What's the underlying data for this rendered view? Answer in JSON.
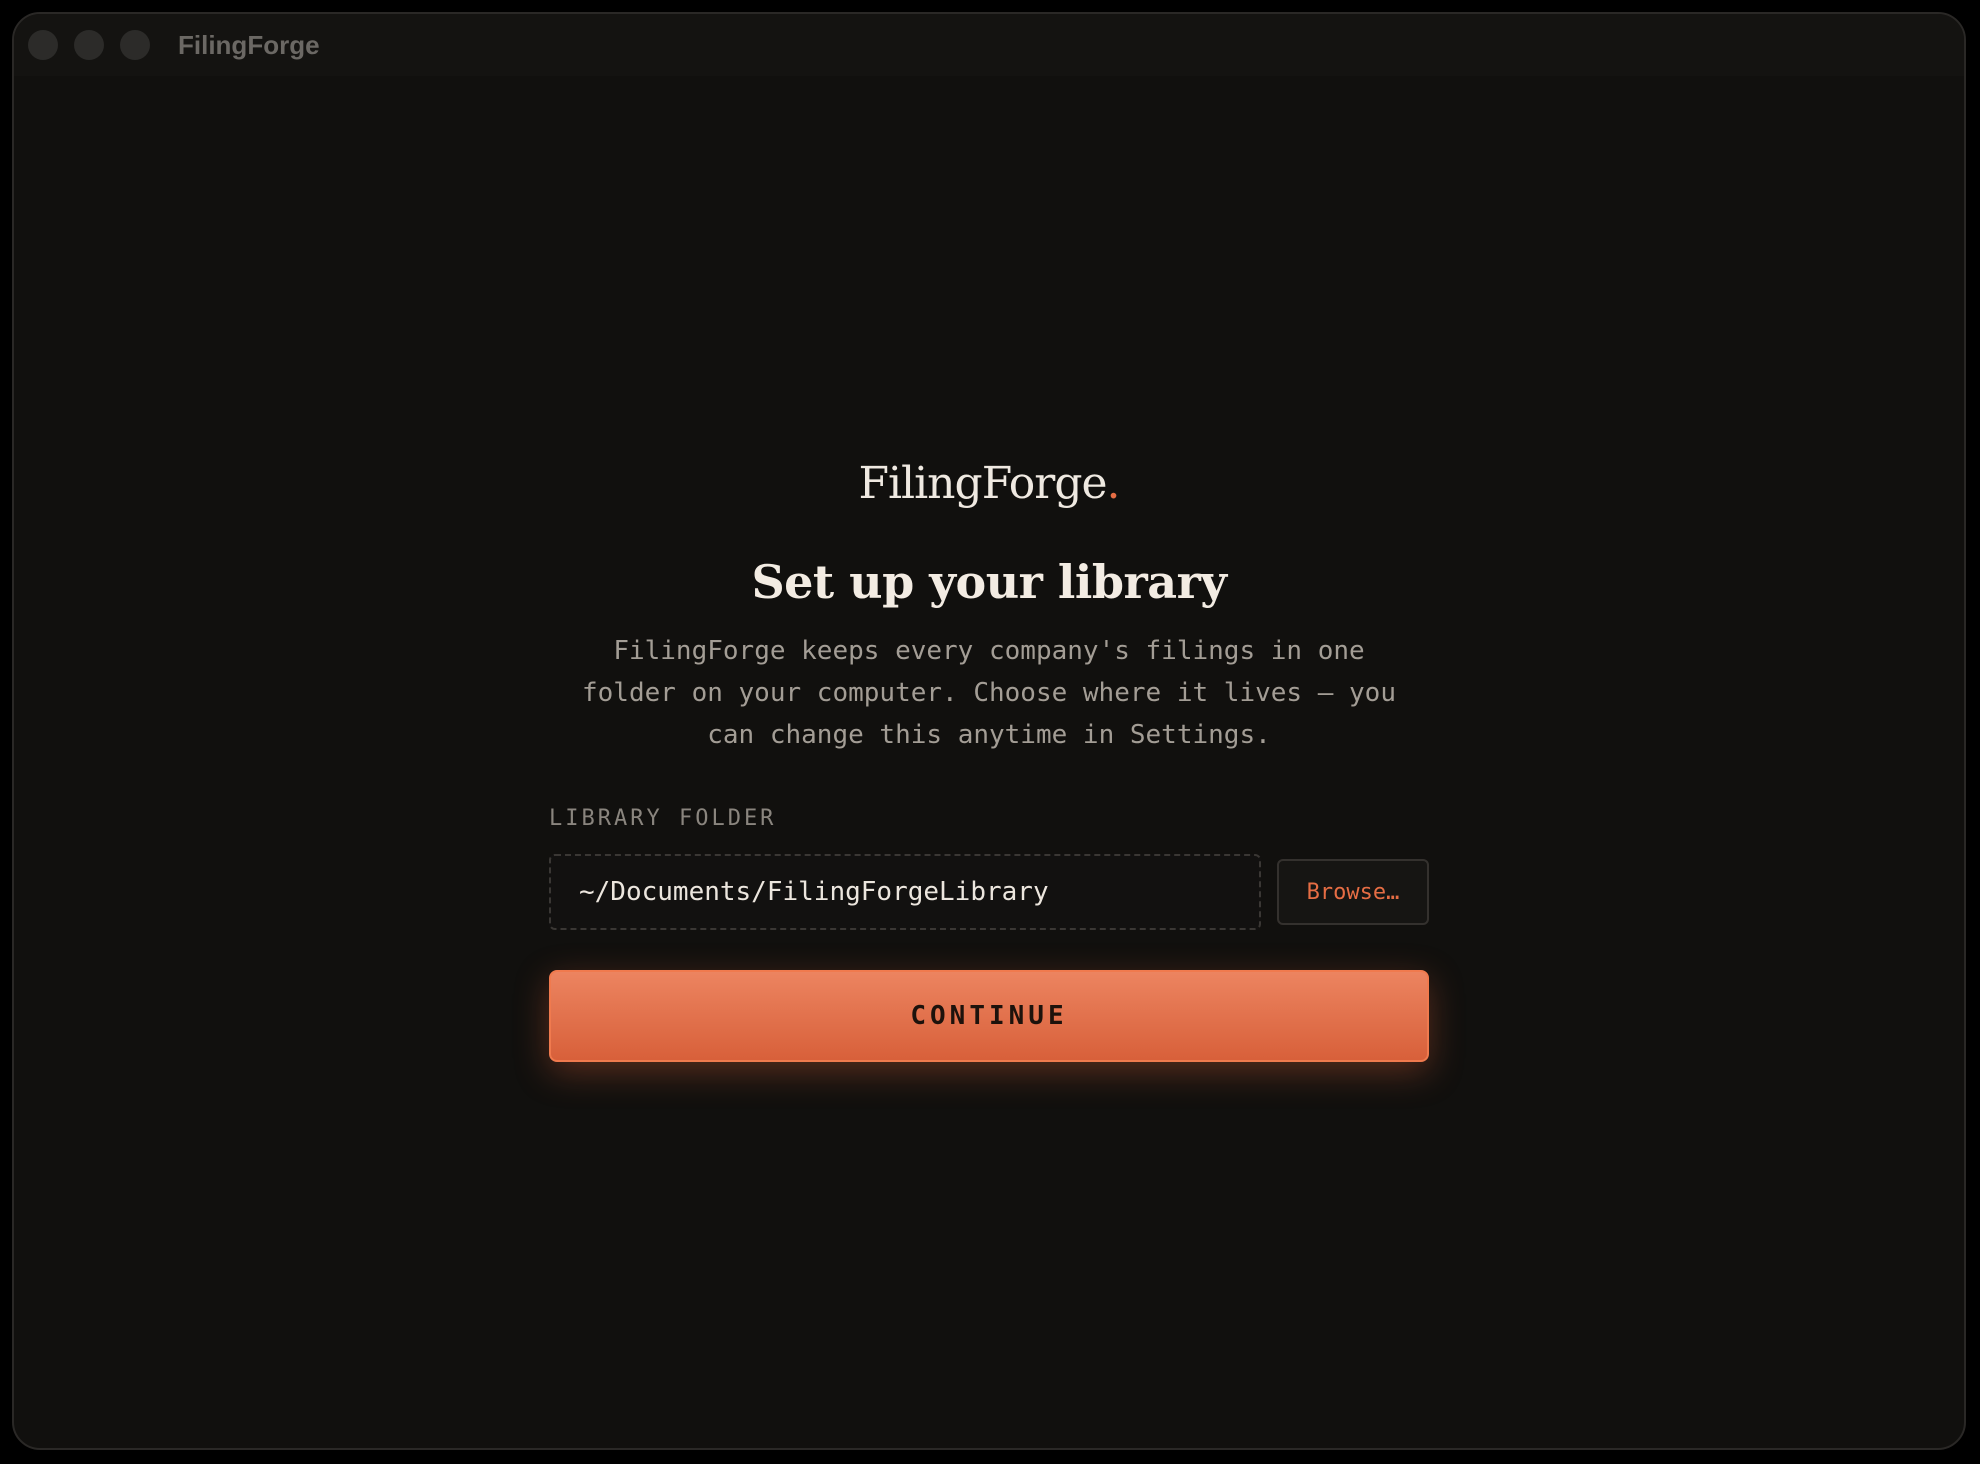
{
  "window": {
    "title": "FilingForge"
  },
  "brand": {
    "name": "FilingForge",
    "dot": ".",
    "accent_color": "#e66d44"
  },
  "main": {
    "heading": "Set up your library",
    "description": "FilingForge keeps every company's filings in one folder on your computer. Choose where it lives — you can change this anytime in Settings."
  },
  "form": {
    "folder_label": "LIBRARY FOLDER",
    "folder_value": "~/Documents/FilingForgeLibrary",
    "browse_label": "Browse…",
    "continue_label": "CONTINUE"
  },
  "icons": {
    "close": "close-icon",
    "minimize": "minimize-icon",
    "zoom": "zoom-icon"
  }
}
